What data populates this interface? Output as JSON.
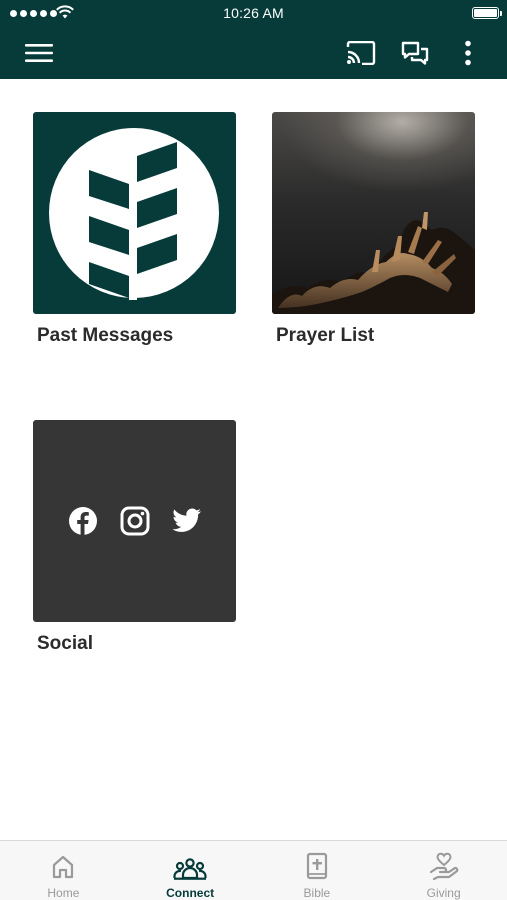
{
  "status_bar": {
    "time": "10:26 AM"
  },
  "toolbar": {
    "menu_icon": "hamburger-menu-icon",
    "cast_icon": "cast-icon",
    "chat_icon": "chat-bubbles-icon",
    "more_icon": "more-vertical-icon"
  },
  "tiles": [
    {
      "label": "Past Messages",
      "image": "church-logo"
    },
    {
      "label": "Prayer List",
      "image": "raised-hands-photo"
    },
    {
      "label": "Social",
      "icons": [
        "facebook-icon",
        "instagram-icon",
        "twitter-icon"
      ]
    }
  ],
  "tabs": [
    {
      "label": "Home",
      "icon": "home-icon",
      "active": false
    },
    {
      "label": "Connect",
      "icon": "people-group-icon",
      "active": true
    },
    {
      "label": "Bible",
      "icon": "bible-icon",
      "active": false
    },
    {
      "label": "Giving",
      "icon": "giving-heart-hand-icon",
      "active": false
    }
  ],
  "colors": {
    "brand": "#063b3a",
    "tile_dark": "#363636",
    "tab_inactive": "#9a9a9a"
  }
}
